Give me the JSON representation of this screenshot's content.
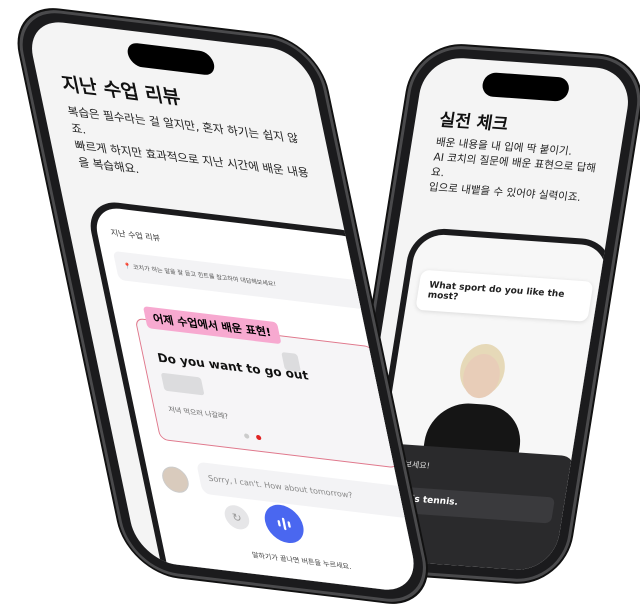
{
  "left_phone": {
    "heading": "지난 수업 리뷰",
    "description": [
      "복습은 필수라는 걸 알지만, 혼자 하기는 쉽지 않죠.",
      "빠르게 하지만 효과적으로 지난 시간에 배운 내용을 복습해요."
    ],
    "app": {
      "screen_title": "지난 수업 리뷰",
      "hint": "코치가 하는 말을 잘 듣고 힌트를 참고하여 대답해보세요!",
      "highlight_label": "어제 수업에서 배운 표현!",
      "sentence": "Do you want to go out",
      "translation": "저녁 먹으러 나갈래?",
      "reply": "Sorry, I can't. How about tomorrow?",
      "footer": "말하기가 끝나면 버튼을 누르세요.",
      "page_count": 2,
      "active_page": 2,
      "colors": {
        "accent": "#4a67f0",
        "card_border": "#e0788c",
        "highlight": "#f7a9d0",
        "active_dot": "#e02424"
      }
    }
  },
  "right_phone": {
    "heading": "실전 체크",
    "description": [
      "배운 내용을 내 입에 딱 붙이기.",
      "AI 코치의 질문에 배운 표현으로 답해요.",
      "입으로 내뱉을 수 있어야 실력이죠."
    ],
    "app": {
      "question": "What sport do you like the most?",
      "prompt": "해 보세요!",
      "answer": "ort is tennis.",
      "colors": {
        "mic": "#ef3b3b",
        "sheet": "#2a2a2c"
      }
    }
  }
}
